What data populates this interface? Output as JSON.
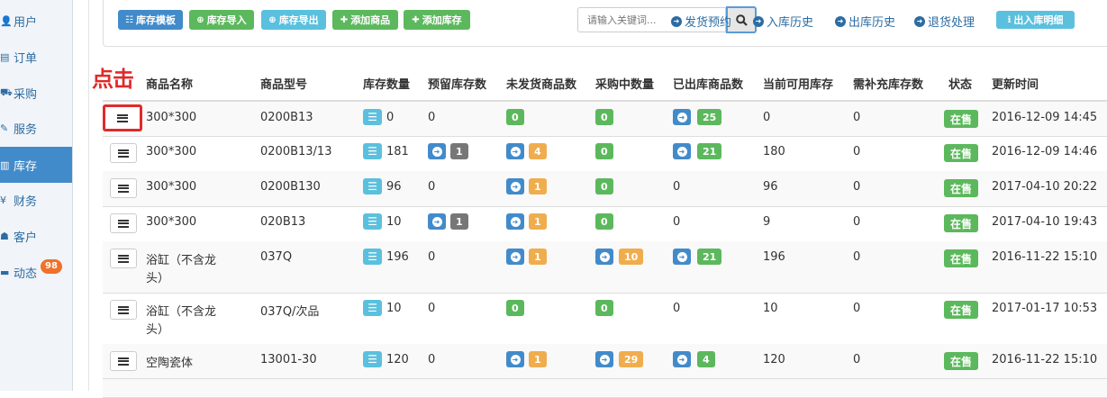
{
  "sidebar": {
    "items": [
      {
        "label": "用户",
        "icon": "user-icon",
        "glyph": "👤"
      },
      {
        "label": "订单",
        "icon": "order-icon",
        "glyph": "▤"
      },
      {
        "label": "采购",
        "icon": "cart-icon",
        "glyph": "⛟"
      },
      {
        "label": "服务",
        "icon": "wrench-icon",
        "glyph": "✎"
      },
      {
        "label": "库存",
        "icon": "barcode-icon",
        "glyph": "▥",
        "active": true
      },
      {
        "label": "财务",
        "icon": "yen-icon",
        "glyph": "¥"
      },
      {
        "label": "客户",
        "icon": "customer-icon",
        "glyph": "☗"
      },
      {
        "label": "动态",
        "icon": "comment-icon",
        "glyph": "▬",
        "badge": "98"
      }
    ]
  },
  "toolbar": {
    "buttons": [
      {
        "label": "库存模板",
        "icon": "list-icon",
        "glyph": "☷",
        "color": "#428bca"
      },
      {
        "label": "库存导入",
        "icon": "upload-icon",
        "glyph": "⊕",
        "color": "#5cb85c"
      },
      {
        "label": "库存导出",
        "icon": "download-icon",
        "glyph": "⊕",
        "color": "#5bc0de"
      },
      {
        "label": "添加商品",
        "icon": "plus-icon",
        "glyph": "✚",
        "color": "#5cb85c"
      },
      {
        "label": "添加库存",
        "icon": "plus-icon",
        "glyph": "✚",
        "color": "#5cb85c"
      }
    ],
    "search_placeholder": "请输入关键词...",
    "links": [
      "发货预约",
      "入库历史",
      "出库历史",
      "退货处理"
    ],
    "detail_button": "出入库明细"
  },
  "annotation": {
    "text": "点击"
  },
  "table": {
    "headers": [
      "商品名称",
      "商品型号",
      "库存数量",
      "预留库存数",
      "未发货商品数",
      "采购中数量",
      "已出库商品数",
      "当前可用库存",
      "需补充库存数",
      "状态",
      "更新时间"
    ],
    "rows": [
      {
        "name": [
          "300*300"
        ],
        "model": "0200B13",
        "stock": "0",
        "reserved": "0",
        "reserved_badge": null,
        "unshipped": "0",
        "unshipped_color": "green",
        "purchasing": "0",
        "purchasing_color": "green",
        "shipped": "25",
        "available": "0",
        "replenish": "0",
        "status": "在售",
        "updated": "2016-12-09 14:45"
      },
      {
        "name": [
          "300*300"
        ],
        "model": "0200B13/13",
        "stock": "181",
        "reserved": null,
        "reserved_badge": "1",
        "unshipped": "4",
        "unshipped_color": "orange",
        "purchasing": "0",
        "purchasing_color": "green",
        "shipped": "21",
        "available": "180",
        "replenish": "0",
        "status": "在售",
        "updated": "2016-12-09 14:46"
      },
      {
        "name": [
          "300*300"
        ],
        "model": "0200B130",
        "stock": "96",
        "reserved": "0",
        "reserved_badge": null,
        "unshipped": "1",
        "unshipped_color": "orange",
        "purchasing": "0",
        "purchasing_color": "green",
        "shipped": null,
        "shipped_text": "0",
        "available": "96",
        "replenish": "0",
        "status": "在售",
        "updated": "2017-04-10 20:22"
      },
      {
        "name": [
          "300*300"
        ],
        "model": "020B13",
        "stock": "10",
        "reserved": null,
        "reserved_badge": "1",
        "unshipped": "1",
        "unshipped_color": "orange",
        "purchasing": "0",
        "purchasing_color": "green",
        "shipped": null,
        "shipped_text": "0",
        "available": "9",
        "replenish": "0",
        "status": "在售",
        "updated": "2017-04-10 19:43"
      },
      {
        "name": [
          "浴缸（不含龙",
          "头）"
        ],
        "model": "037Q",
        "stock": "196",
        "reserved": "0",
        "reserved_badge": null,
        "unshipped": "1",
        "unshipped_color": "orange",
        "purchasing": "10",
        "purchasing_color": "orange",
        "purchasing_go": true,
        "shipped": "21",
        "available": "196",
        "replenish": "0",
        "status": "在售",
        "updated": "2016-11-22 15:10"
      },
      {
        "name": [
          "浴缸（不含龙",
          "头）"
        ],
        "model": "037Q/次品",
        "stock": "10",
        "reserved": "0",
        "reserved_badge": null,
        "unshipped": "0",
        "unshipped_color": "green",
        "unshipped_nogo": true,
        "purchasing": "0",
        "purchasing_color": "green",
        "shipped": null,
        "shipped_text": "0",
        "available": "10",
        "replenish": "0",
        "status": "在售",
        "updated": "2017-01-17 10:53"
      },
      {
        "name": [
          "空陶瓷体"
        ],
        "model": "13001-30",
        "stock": "120",
        "reserved": "0",
        "reserved_badge": null,
        "unshipped": "1",
        "unshipped_color": "orange",
        "purchasing": "29",
        "purchasing_color": "orange",
        "purchasing_go": true,
        "shipped": "4",
        "available": "120",
        "replenish": "0",
        "status": "在售",
        "updated": "2016-11-22 15:10"
      }
    ]
  },
  "colors": {
    "primary": "#428bca",
    "success": "#5cb85c",
    "info": "#5bc0de",
    "warning": "#f0ad4e",
    "gray": "#777777",
    "annotation": "#e02a2a",
    "badge": "#f0712a"
  }
}
